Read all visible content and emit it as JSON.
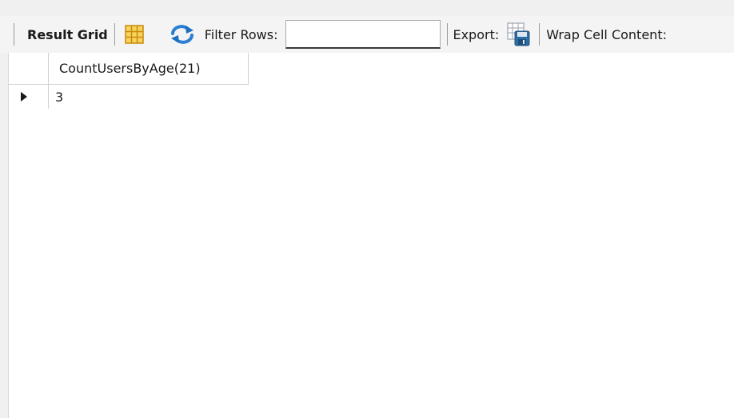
{
  "toolbar": {
    "result_grid_label": "Result Grid",
    "filter_rows_label": "Filter Rows:",
    "filter_rows_value": "",
    "export_label": "Export:",
    "wrap_cell_label": "Wrap Cell Content:",
    "icons": [
      "grid-layout-icon",
      "refresh-icon",
      "export-table-icon"
    ]
  },
  "grid": {
    "columns": [
      "CountUsersByAge(21)"
    ],
    "rows": [
      {
        "values": [
          "3"
        ]
      }
    ]
  },
  "colors": {
    "toolbar_bg": "#f4f4f4",
    "grid_bg": "#ffffff",
    "icon_orange": "#e8a317",
    "icon_blue": "#1e6fc0",
    "row_marker": "#1a1a1a"
  }
}
